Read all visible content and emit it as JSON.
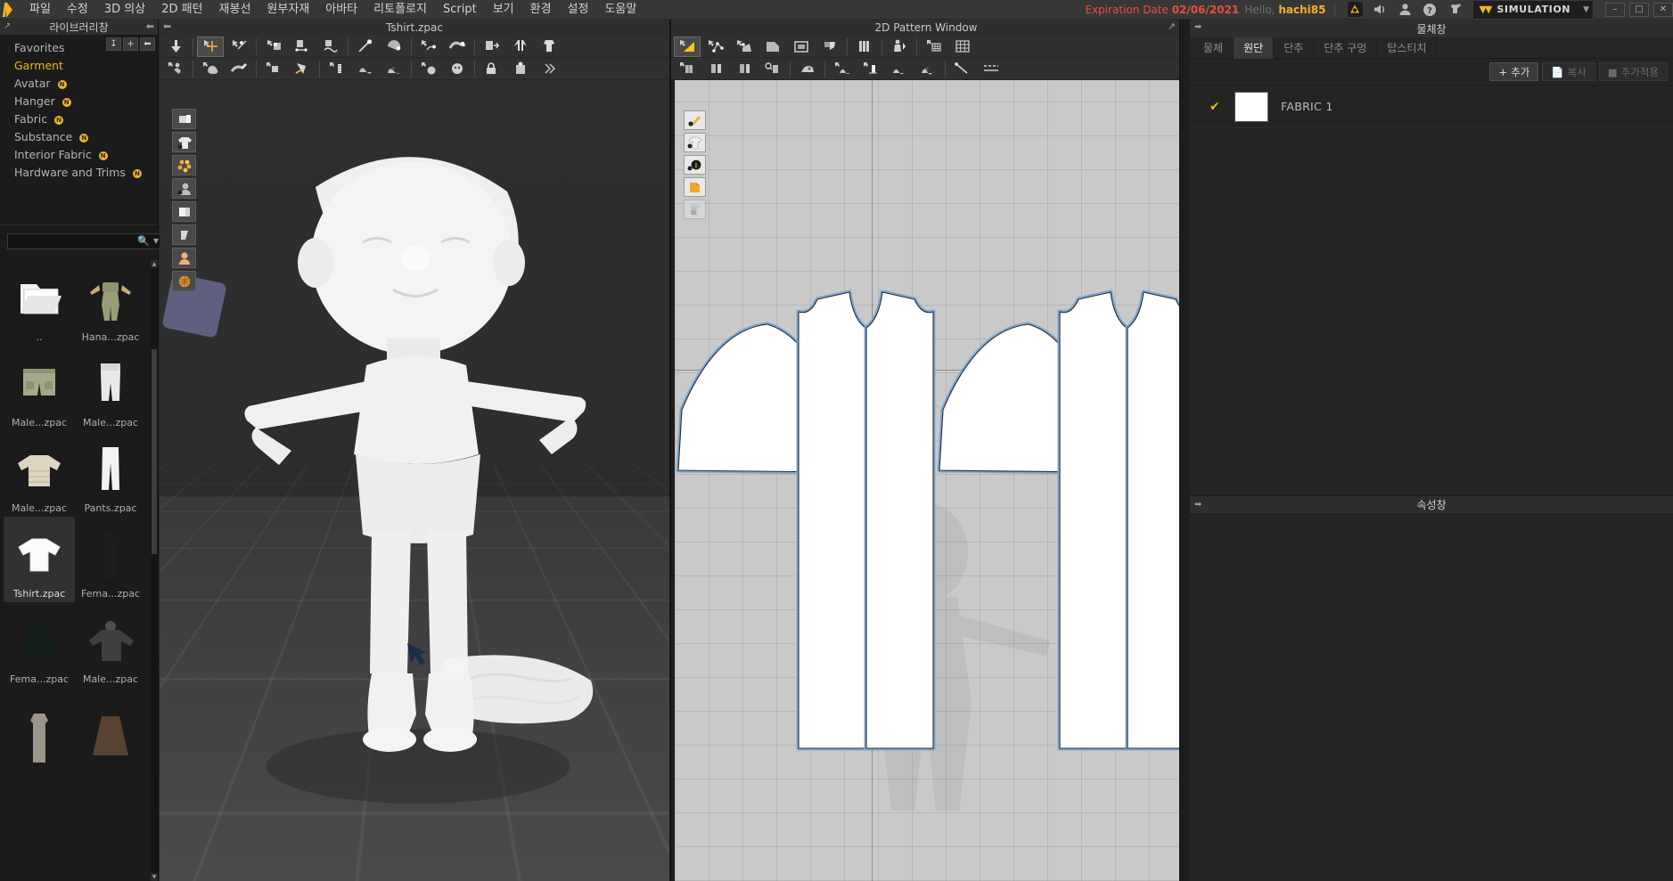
{
  "menubar": {
    "logo": "clo-logo",
    "items": [
      "파일",
      "수정",
      "3D 의상",
      "2D 패턴",
      "재봉선",
      "원부자재",
      "아바타",
      "리토폴로지",
      "Script",
      "보기",
      "환경",
      "설정",
      "도움말"
    ],
    "expiration_label": "Expiration Date",
    "expiration_date": "02/06/2021",
    "hello_label": "Hello,",
    "user": "hachi85",
    "right_icons": [
      "c-badge-icon",
      "speaker-icon",
      "user-icon",
      "help-icon",
      "add-garment-icon"
    ],
    "simulation_label": "SIMULATION",
    "window_controls": [
      "–",
      "□",
      "✕"
    ],
    "colors": {
      "accent": "#f5b223",
      "expiration": "#e0533c",
      "menu_bg": "#373737"
    }
  },
  "library": {
    "title": "라이브러리창",
    "collapse_icon": "collapse-left-icon",
    "expand_icon": "expand-window-icon",
    "tools": [
      "download-icon",
      "plus-icon",
      "back-arrow-icon"
    ],
    "tree": [
      {
        "label": "Favorites",
        "badge": "",
        "selected": false
      },
      {
        "label": "Garment",
        "badge": "",
        "selected": true
      },
      {
        "label": "Avatar",
        "badge": "N",
        "selected": false
      },
      {
        "label": "Hanger",
        "badge": "N",
        "selected": false
      },
      {
        "label": "Fabric",
        "badge": "N",
        "selected": false
      },
      {
        "label": "Substance",
        "badge": "N",
        "selected": false
      },
      {
        "label": "Interior Fabric",
        "badge": "N",
        "selected": false
      },
      {
        "label": "Hardware and Trims",
        "badge": "N",
        "selected": false
      }
    ],
    "search": {
      "value": "",
      "placeholder": "",
      "icon": "search-icon",
      "caret": "chevron-down-icon"
    },
    "refresh_icon": "refresh-icon",
    "listview_icon": "list-view-icon",
    "files": [
      {
        "name": "..",
        "type": "folder-up",
        "selected": false
      },
      {
        "name": "Hana...zpac",
        "type": "avatar-outfit",
        "selected": false
      },
      {
        "name": "Male...zpac",
        "type": "shorts",
        "selected": false
      },
      {
        "name": "Male...zpac",
        "type": "joggers",
        "selected": false
      },
      {
        "name": "Male...zpac",
        "type": "puffer-jacket",
        "selected": false
      },
      {
        "name": "Pants.zpac",
        "type": "pants",
        "selected": false
      },
      {
        "name": "Tshirt.zpac",
        "type": "tshirt",
        "selected": true
      },
      {
        "name": "Fema...zpac",
        "type": "dark-dress",
        "selected": false
      },
      {
        "name": "Fema...zpac",
        "type": "dark-skirt",
        "selected": false
      },
      {
        "name": "Male...zpac",
        "type": "dark-sweater",
        "selected": false
      },
      {
        "name": "",
        "type": "gray-dress",
        "selected": false
      },
      {
        "name": "",
        "type": "brown-skirt",
        "selected": false
      }
    ]
  },
  "view3d": {
    "title": "Tshirt.zpac",
    "collapse_icon": "collapse-left-icon",
    "toolbar_row1": [
      "gravity-icon",
      "transform-move-icon",
      "transform-rotate-icon",
      "fold-arrange-icon",
      "sew-line-icon",
      "free-sew-icon",
      "pin-icon",
      "tack-icon",
      "select-mesh-icon",
      "brush-mesh-icon",
      "flatten-icon",
      "arrange-symmetry-icon",
      "arrange-garment-icon"
    ],
    "toolbar_row2": [
      "pose-icon",
      "skin-icon",
      "edit-avatar-icon",
      "glue-icon",
      "pressure-icon",
      "zipper-icon",
      "button-icon",
      "buttonhole-icon",
      "topstitch-icon",
      "puckering-icon",
      "lock-icon",
      "trim-icon",
      "more-icon"
    ],
    "left_tools": [
      "print-layout-icon",
      "garment-visibility-icon",
      "particle-distance-icon",
      "avatar-visibility-icon",
      "texture-icon",
      "shade-icon",
      "skin-offset-icon",
      "uv-map-icon"
    ],
    "active_tool": "transform-move-icon"
  },
  "pattern2d": {
    "title": "2D Pattern Window",
    "expand_icon": "expand-window-icon",
    "toolbar_row1": [
      "edit-pattern-icon",
      "edit-curve-point-icon",
      "edit-curvature-icon",
      "create-polygon-icon",
      "create-rectangle-icon",
      "create-internal-icon",
      "pleat-fold-icon",
      "baseline-icon",
      "grid-small-icon",
      "grid-large-icon"
    ],
    "toolbar_row2": [
      "sew-segment-icon",
      "sew-free-icon",
      "sew-mn-icon",
      "check-sew-icon",
      "iron-icon",
      "fabric-texture-icon",
      "trace-icon",
      "layer-icon",
      "bond-icon",
      "measure-icon"
    ],
    "left_tools": [
      "draw-visibility-icon",
      "pattern-visibility-icon",
      "info-visibility-icon",
      "fold-visibility-icon",
      "lock-visibility-icon"
    ],
    "active_tool": "edit-pattern-icon",
    "pieces": [
      {
        "name": "sleeve-left",
        "kind": "sleeve"
      },
      {
        "name": "body-front-back",
        "kind": "body-pair"
      },
      {
        "name": "sleeve-right",
        "kind": "sleeve"
      },
      {
        "name": "body-front-back-2",
        "kind": "body-pair"
      }
    ],
    "colors": {
      "canvas": "#c9c9c9",
      "piece_fill": "#ffffff",
      "seam": "#7aa8d4"
    }
  },
  "right_panel": {
    "object_window": {
      "title": "물체창",
      "collapse_icon": "collapse-right-icon",
      "expand_icon": "expand-window-icon",
      "tabs": [
        {
          "label": "물체",
          "active": false
        },
        {
          "label": "원단",
          "active": true
        },
        {
          "label": "단추",
          "active": false
        },
        {
          "label": "단추 구멍",
          "active": false
        },
        {
          "label": "탑스티치",
          "active": false
        }
      ],
      "actions": [
        {
          "label": "추가",
          "icon": "plus-icon",
          "enabled": true
        },
        {
          "label": "복사",
          "icon": "copy-icon",
          "enabled": false
        },
        {
          "label": "추가적용",
          "icon": "apply-icon",
          "enabled": false
        }
      ],
      "rows": [
        {
          "checked": true,
          "swatch_color": "#ffffff",
          "name": "FABRIC 1"
        }
      ]
    },
    "property_window": {
      "title": "속성창",
      "collapse_icon": "collapse-right-icon"
    }
  }
}
